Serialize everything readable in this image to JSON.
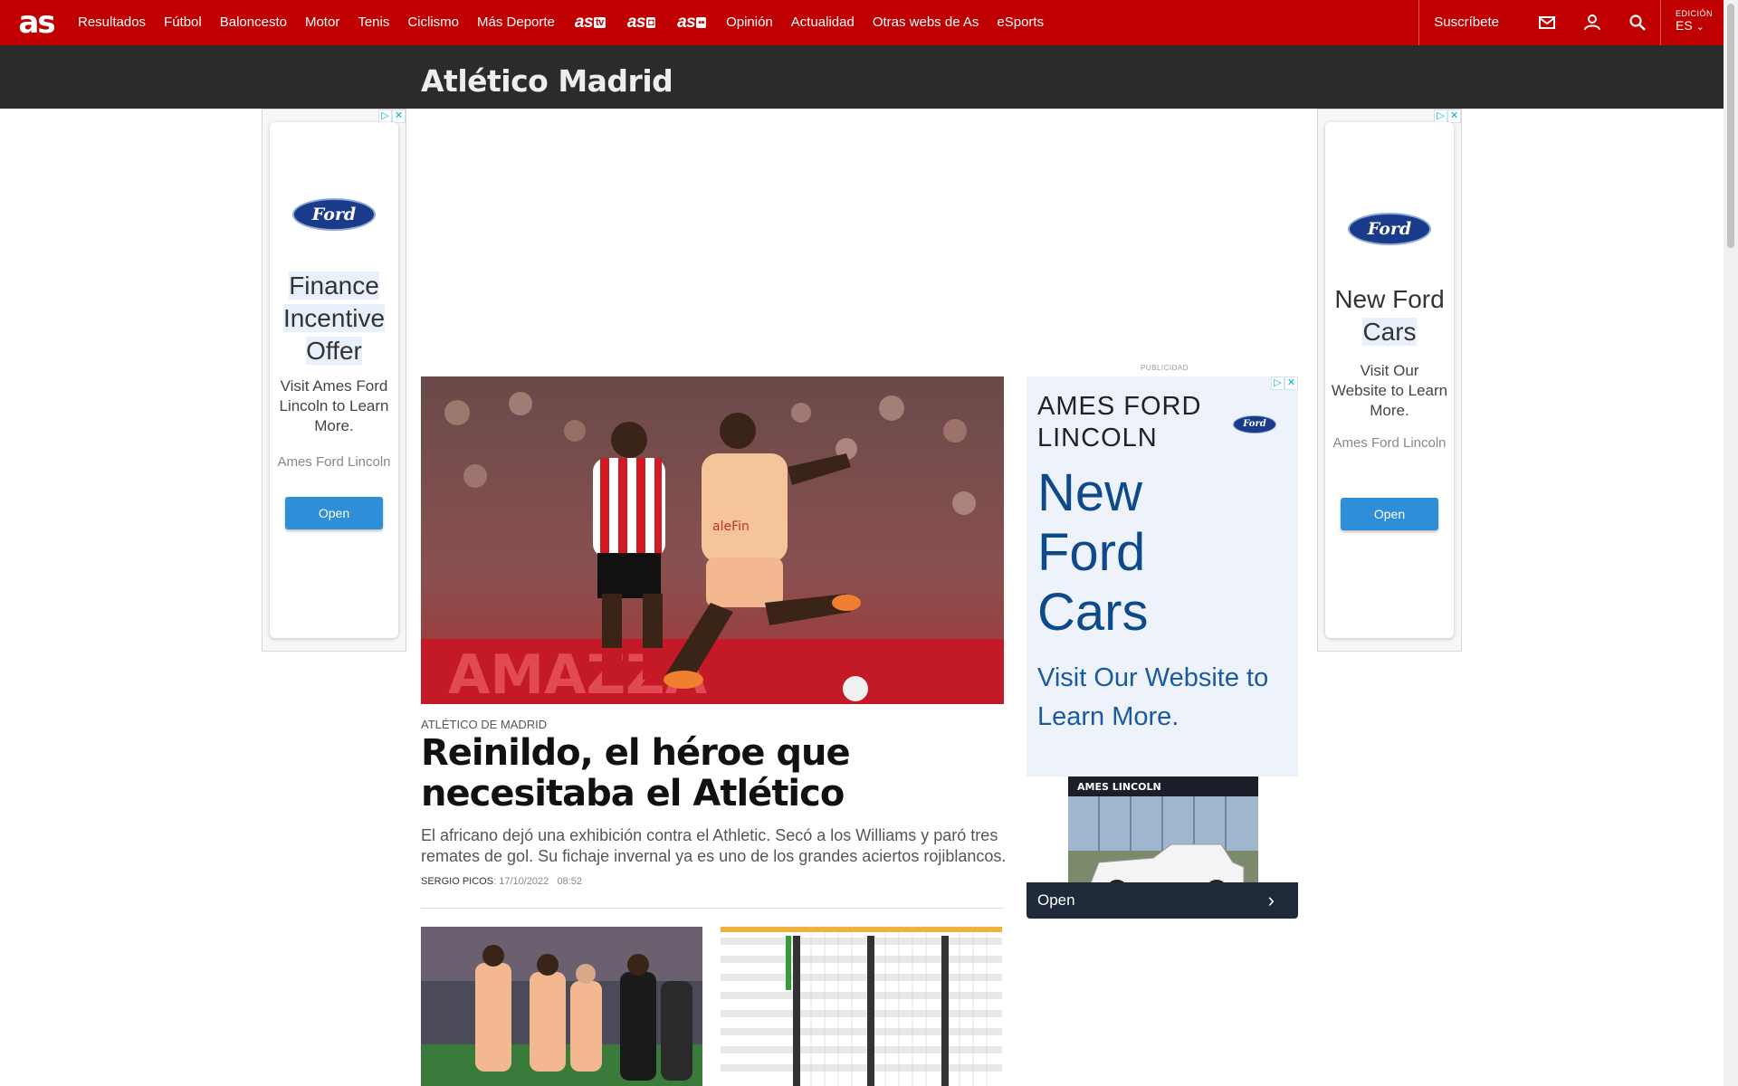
{
  "nav": {
    "logo": "as",
    "items": [
      "Resultados",
      "Fútbol",
      "Baloncesto",
      "Motor",
      "Tenis",
      "Ciclismo",
      "Más Deporte"
    ],
    "brands": [
      {
        "name": "as",
        "badge": "tv"
      },
      {
        "name": "as",
        "badge": "📷"
      },
      {
        "name": "as",
        "badge": "color"
      }
    ],
    "items2": [
      "Opinión",
      "Actualidad",
      "Otras webs de As",
      "eSports"
    ],
    "subscribe": "Suscríbete",
    "edition_label": "EDICIÓN",
    "edition_value": "ES",
    "colors": {
      "brand": "#c00000",
      "section_bar": "#2b2b2b"
    }
  },
  "section": {
    "title": "Atlético Madrid"
  },
  "left_ad": {
    "brand": "Ford",
    "headline": [
      "Finance",
      "Incentive",
      "Offer"
    ],
    "sub": "Visit Ames Ford Lincoln to Learn More.",
    "advertiser": "Ames Ford Lincoln",
    "button": "Open"
  },
  "right_ad": {
    "brand": "Ford",
    "headline": [
      "New Ford",
      "Cars"
    ],
    "sub": "Visit Our Website to Learn More.",
    "advertiser": "Ames Ford Lincoln",
    "button": "Open"
  },
  "article": {
    "kicker": "ATLÉTICO DE MADRID",
    "headline": "Reinildo, el héroe que necesitaba el Atlético",
    "summary": "El africano dejó una exhibición contra el Athletic. Secó a los Williams y paró tres remates de gol. Su fichaje invernal ya es uno de los grandes aciertos rojiblancos.",
    "author": "SERGIO PICOS",
    "date": "17/10/2022",
    "time": "08:52"
  },
  "mid_ad": {
    "label": "PUBLICIDAD",
    "advertiser": "AMES FORD LINCOLN",
    "brand": "Ford",
    "headline": [
      "New",
      "Ford",
      "Cars"
    ],
    "sub": "Visit Our Website to Learn More.",
    "button": "Open",
    "photo_sign": "AMES LINCOLN"
  }
}
